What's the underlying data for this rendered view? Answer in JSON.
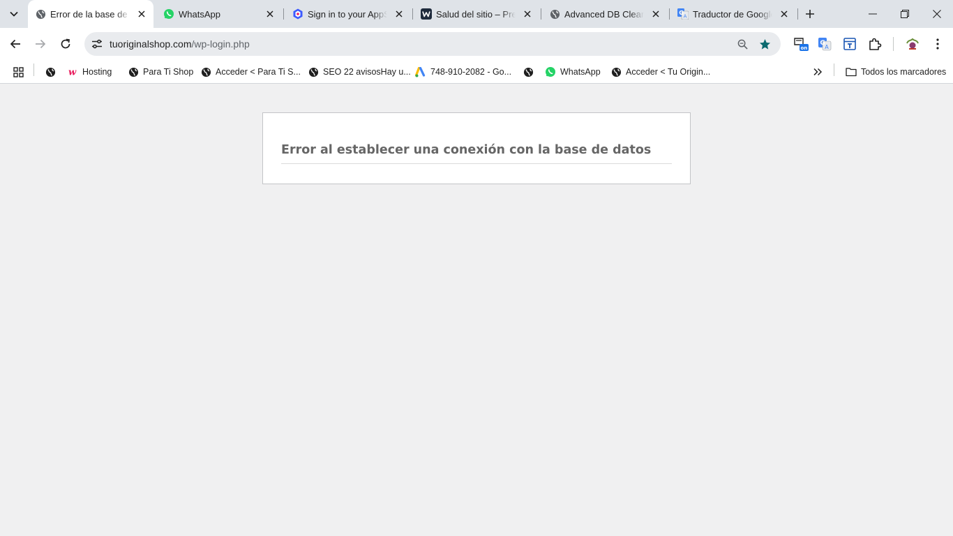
{
  "browser": {
    "tabs": [
      {
        "title": "Error de la base de datos",
        "icon": "globe-icon",
        "active": true
      },
      {
        "title": "WhatsApp",
        "icon": "whatsapp-icon",
        "active": false
      },
      {
        "title": "Sign in to your AppSheet",
        "icon": "appsheet-icon",
        "active": false
      },
      {
        "title": "Salud del sitio – Preguntas",
        "icon": "wp-site-icon",
        "active": false
      },
      {
        "title": "Advanced DB Cleaner",
        "icon": "globe-icon",
        "active": false
      },
      {
        "title": "Traductor de Google",
        "icon": "google-translate-icon",
        "active": false
      }
    ],
    "address": {
      "host": "tuoriginalshop.com",
      "path": "/wp-login.php"
    },
    "bookmarks": [
      {
        "label": "",
        "icon": "globe-icon"
      },
      {
        "label": "Hosting",
        "icon": "hosting-w-icon"
      },
      {
        "label": "Para Ti Shop",
        "icon": "globe-icon"
      },
      {
        "label": "Acceder < Para Ti S...",
        "icon": "globe-icon"
      },
      {
        "label": "SEO 22 avisosHay u...",
        "icon": "globe-icon"
      },
      {
        "label": "748-910-2082 - Go...",
        "icon": "google-ads-icon"
      },
      {
        "label": "",
        "icon": "globe-icon"
      },
      {
        "label": "WhatsApp",
        "icon": "whatsapp-icon"
      },
      {
        "label": "Acceder < Tu Origin...",
        "icon": "globe-icon"
      }
    ],
    "all_bookmarks_label": "Todos los marcadores",
    "colors": {
      "tabstrip": "#dfe3e8",
      "bookmark_star": "#0b6a6f",
      "whatsapp": "#25d366"
    }
  },
  "page": {
    "error_message": "Error al establecer una conexión con la base de datos"
  }
}
